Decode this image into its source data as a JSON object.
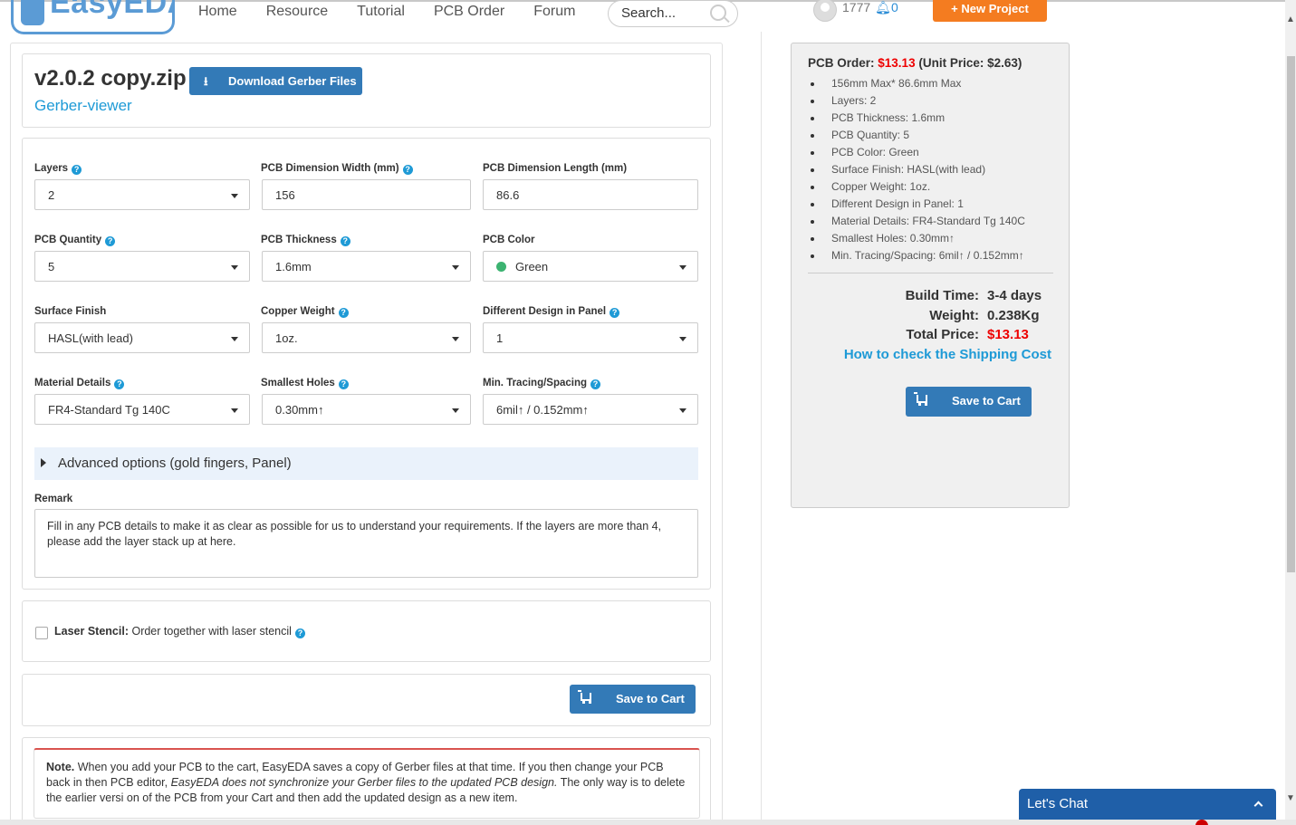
{
  "nav": {
    "logo": "EasyEDA",
    "links": [
      "Home",
      "Resource",
      "Tutorial",
      "PCB Order",
      "Forum"
    ],
    "search_placeholder": "Search...",
    "user_count": "1777",
    "notif_count": "0",
    "new_project": "New Project"
  },
  "header": {
    "filename": "v2.0.2 copy.zip",
    "download_btn": "Download Gerber Files",
    "viewer_link": "Gerber-viewer"
  },
  "form": {
    "layers": {
      "label": "Layers",
      "value": "2"
    },
    "width": {
      "label": "PCB Dimension Width (mm)",
      "value": "156"
    },
    "length": {
      "label": "PCB Dimension Length (mm)",
      "value": "86.6"
    },
    "quantity": {
      "label": "PCB Quantity",
      "value": "5"
    },
    "thickness": {
      "label": "PCB Thickness",
      "value": "1.6mm"
    },
    "color": {
      "label": "PCB Color",
      "value": "Green",
      "swatch": "#3cb371"
    },
    "surface": {
      "label": "Surface Finish",
      "value": "HASL(with lead)"
    },
    "copper": {
      "label": "Copper Weight",
      "value": "1oz."
    },
    "design": {
      "label": "Different Design in Panel",
      "value": "1"
    },
    "material": {
      "label": "Material Details",
      "value": "FR4-Standard Tg 140C"
    },
    "holes": {
      "label": "Smallest Holes",
      "value": "0.30mm↑"
    },
    "tracing": {
      "label": "Min. Tracing/Spacing",
      "value": "6mil↑ / 0.152mm↑"
    },
    "advanced": "Advanced options (gold fingers, Panel)",
    "remark_label": "Remark",
    "remark_placeholder": "Fill in any PCB details to make it as clear as possible for us to understand your requirements. If the layers are more than 4, please add the layer stack up at here."
  },
  "stencil": {
    "bold": "Laser Stencil:",
    "text": "Order together with laser stencil"
  },
  "save_label": "Save to Cart",
  "note": {
    "bold": "Note.",
    "text1": " When you add your PCB to the cart, EasyEDA saves a copy of Gerber files at that time. If you then change your PCB back in then PCB editor, ",
    "italic": "EasyEDA does not synchronize your Gerber files to the updated PCB design.",
    "text2": " The only way is to delete the earlier versi on of the PCB from your Cart and then add the updated design as a new item."
  },
  "summary": {
    "order_label": "PCB Order:",
    "order_price": "$13.13",
    "unit_price": "(Unit Price: $2.63)",
    "items": [
      "156mm Max* 86.6mm Max",
      "Layers: 2",
      "PCB Thickness: 1.6mm",
      "PCB Quantity: 5",
      "PCB Color: Green",
      "Surface Finish: HASL(with lead)",
      "Copper Weight: 1oz.",
      "Different Design in Panel: 1",
      "Material Details: FR4-Standard Tg 140C",
      "Smallest Holes: 0.30mm↑",
      "Min. Tracing/Spacing: 6mil↑ / 0.152mm↑"
    ],
    "build_time_label": "Build Time:",
    "build_time": "3-4 days",
    "weight_label": "Weight:",
    "weight": "0.238Kg",
    "total_label": "Total Price:",
    "total": "$13.13",
    "shipping_link": "How to check the Shipping Cost"
  },
  "chat": "Let's Chat"
}
